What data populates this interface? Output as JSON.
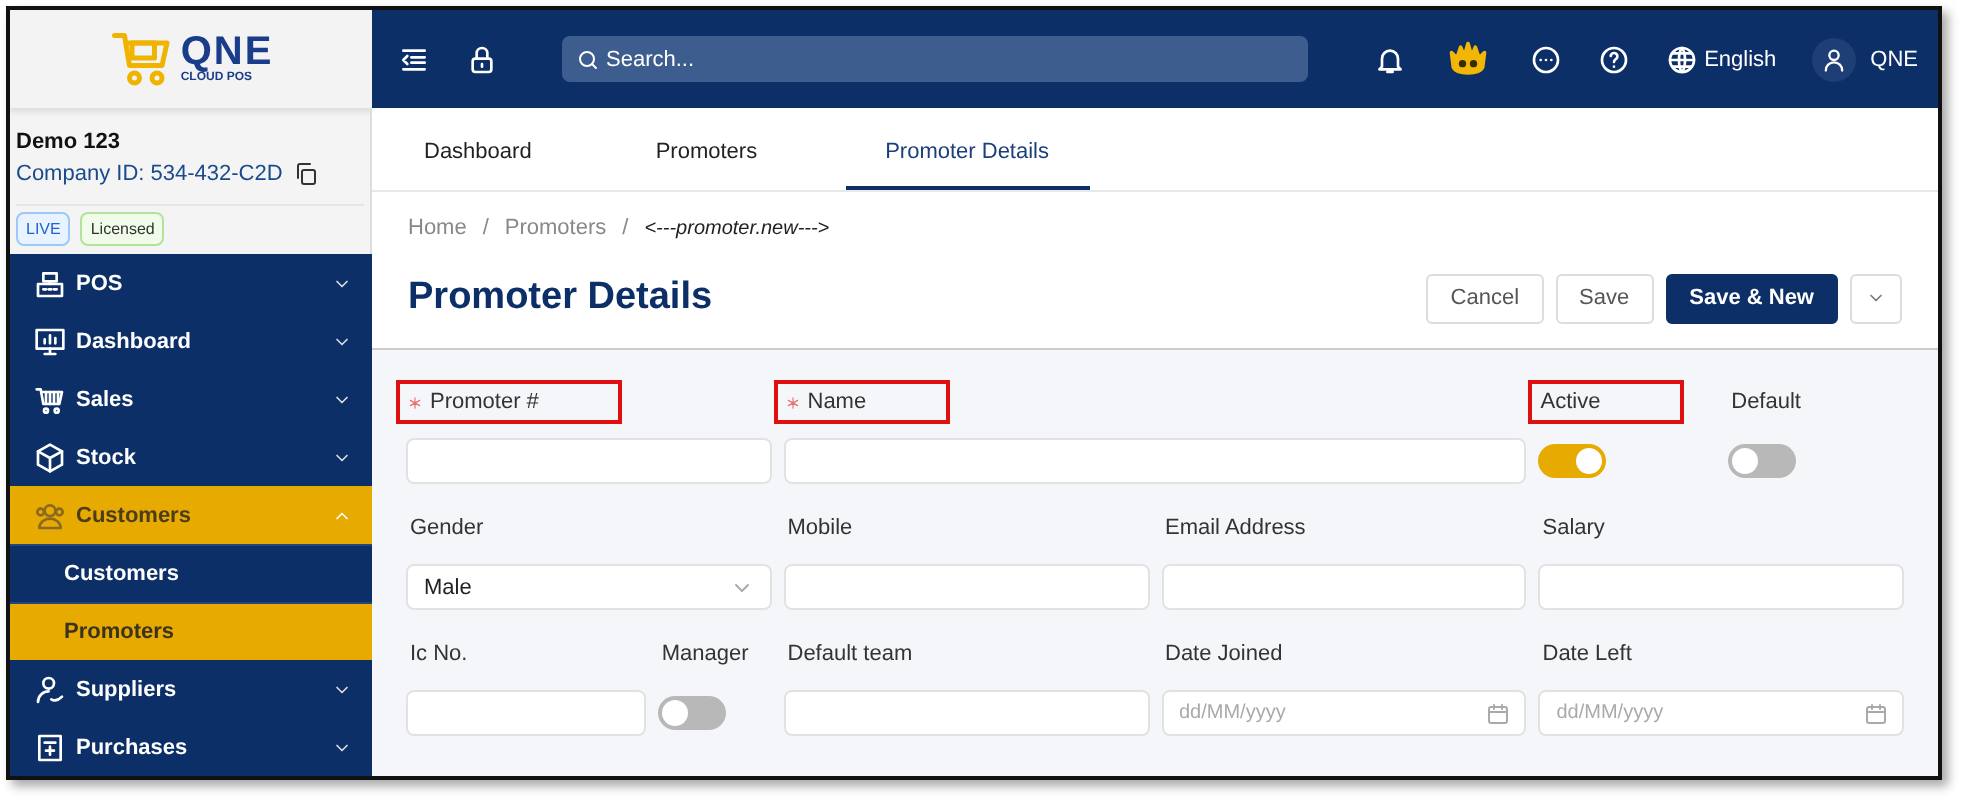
{
  "logo": {
    "title": "QNE",
    "subtitle": "CLOUD POS"
  },
  "company": {
    "name": "Demo 123",
    "id": "Company ID: 534-432-C2D",
    "badges": [
      {
        "label": "LIVE",
        "kind": "live"
      },
      {
        "label": "Licensed",
        "kind": "licensed"
      }
    ]
  },
  "sidebar": {
    "items": [
      {
        "label": "POS",
        "expanded": false,
        "selected": false
      },
      {
        "label": "Dashboard",
        "expanded": false,
        "selected": false
      },
      {
        "label": "Sales",
        "expanded": false,
        "selected": false
      },
      {
        "label": "Stock",
        "expanded": false,
        "selected": false
      },
      {
        "label": "Customers",
        "expanded": true,
        "selected": true,
        "children": [
          {
            "label": "Customers",
            "selected": false
          },
          {
            "label": "Promoters",
            "selected": true
          }
        ]
      },
      {
        "label": "Suppliers",
        "expanded": false,
        "selected": false
      },
      {
        "label": "Purchases",
        "expanded": false,
        "selected": false
      }
    ]
  },
  "header": {
    "search": {
      "placeholder": "Search..."
    },
    "language": "English",
    "user": "QNE"
  },
  "tabs": [
    {
      "label": "Dashboard",
      "selected": false
    },
    {
      "label": "Promoters",
      "selected": false
    },
    {
      "label": "Promoter Details",
      "selected": true
    }
  ],
  "breadcrumb": [
    {
      "label": "Home",
      "kind": "link"
    },
    {
      "label": "/",
      "kind": "separator"
    },
    {
      "label": "Promoters",
      "kind": "link"
    },
    {
      "label": "/",
      "kind": "separator"
    },
    {
      "label": "<---promoter.new--->",
      "kind": "current"
    }
  ],
  "page_title": "Promoter Details",
  "buttons": [
    {
      "label": "Cancel",
      "kind": "default"
    },
    {
      "label": "Save",
      "kind": "default"
    },
    {
      "label": "Save & New",
      "kind": "primary"
    },
    {
      "kind": "menu"
    }
  ],
  "form": {
    "rows": [
      {
        "fields": [
          {
            "label": "Promoter #",
            "kind": "text",
            "required": true,
            "highlighted": true
          },
          {
            "label": "Name",
            "kind": "wide_text",
            "required": true,
            "highlighted": true
          },
          {
            "label": "Active",
            "kind": "toggle",
            "on": true,
            "highlighted": true
          },
          {
            "label": "Default",
            "kind": "toggle",
            "on": false,
            "highlighted": false
          }
        ]
      },
      {
        "fields": [
          {
            "label": "Gender",
            "kind": "select",
            "value": "Male"
          },
          {
            "label": "Mobile",
            "kind": "text"
          },
          {
            "label": "Email Address",
            "kind": "text"
          },
          {
            "label": "Salary",
            "kind": "text"
          }
        ]
      },
      {
        "fields": [
          {
            "label": "Ic No.",
            "kind": "short_text"
          },
          {
            "label": "Manager",
            "kind": "toggle",
            "on": false
          },
          {
            "label": "Default team",
            "kind": "text"
          },
          {
            "label": "Date Joined",
            "kind": "date",
            "placeholder": "dd/MM/yyyy"
          },
          {
            "label": "Date Left",
            "kind": "date",
            "placeholder": "dd/MM/yyyy"
          }
        ]
      }
    ]
  }
}
